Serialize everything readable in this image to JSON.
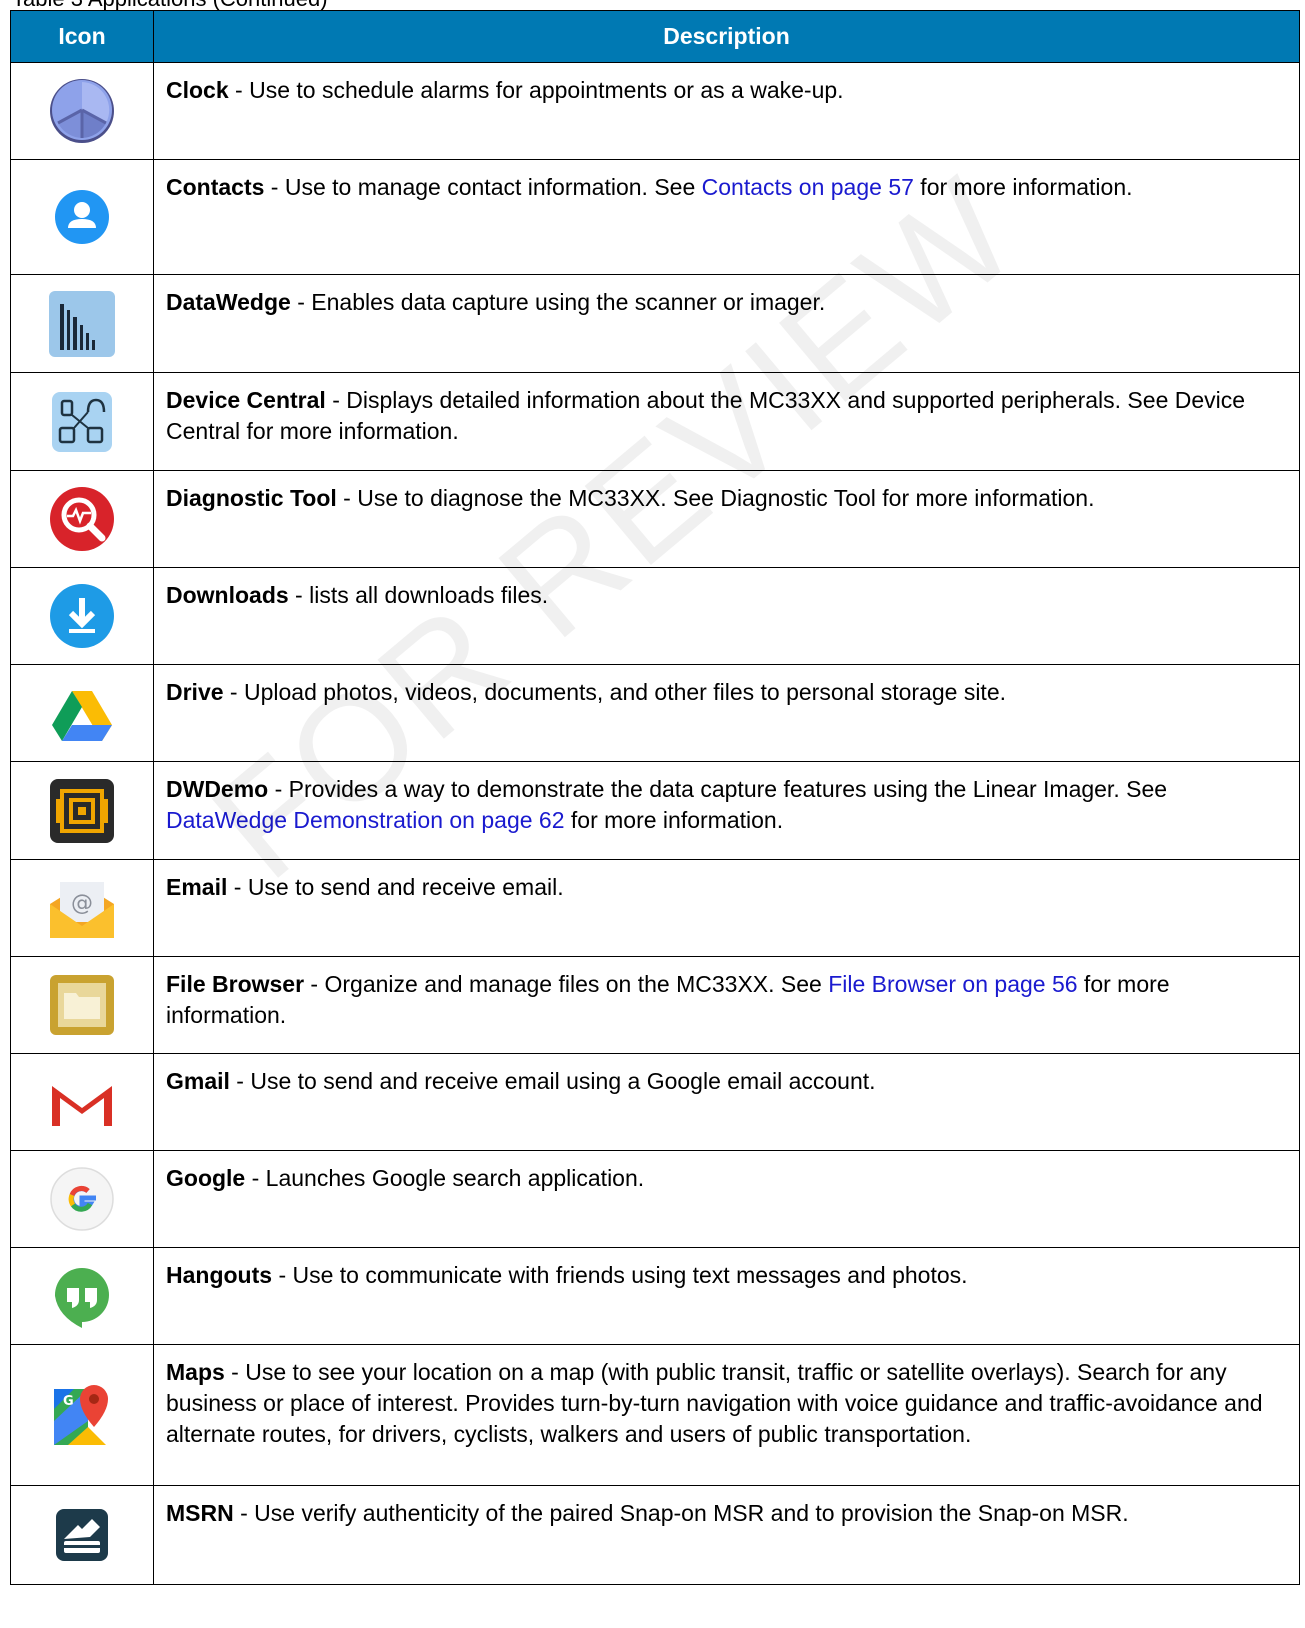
{
  "caption": "Table 3   Applications (Continued)",
  "watermark": "FOR REVIEW",
  "header": {
    "icon": "Icon",
    "description": "Description"
  },
  "rows": [
    {
      "icon": "clock-icon",
      "name": "Clock",
      "text": " - Use to schedule alarms for appointments or as a wake-up.",
      "link": "",
      "after": ""
    },
    {
      "icon": "contacts-icon",
      "name": "Contacts",
      "text": " - Use to manage contact information. See ",
      "link": "Contacts on page 57",
      "after": " for more information."
    },
    {
      "icon": "datawedge-icon",
      "name": "DataWedge",
      "text": " - Enables data capture using the scanner or imager.",
      "link": "",
      "after": ""
    },
    {
      "icon": "device-central-icon",
      "name": "Device Central",
      "text": " - Displays detailed information about the MC33XX and supported peripherals. See Device Central for more information.",
      "link": "",
      "after": ""
    },
    {
      "icon": "diagnostic-tool-icon",
      "name": "Diagnostic Tool",
      "text": " - Use to diagnose the MC33XX. See Diagnostic Tool for more information.",
      "link": "",
      "after": ""
    },
    {
      "icon": "downloads-icon",
      "name": "Downloads",
      "text": " - lists all downloads files.",
      "link": "",
      "after": ""
    },
    {
      "icon": "drive-icon",
      "name": "Drive",
      "text": " - Upload photos, videos, documents, and other files to personal storage site.",
      "link": "",
      "after": ""
    },
    {
      "icon": "dwdemo-icon",
      "name": "DWDemo",
      "text": " - Provides a way to demonstrate the data capture features using the Linear Imager. See ",
      "link": "DataWedge Demonstration on page 62",
      "after": " for more information."
    },
    {
      "icon": "email-icon",
      "name": "Email",
      "text": " - Use to send and receive email.",
      "link": "",
      "after": ""
    },
    {
      "icon": "file-browser-icon",
      "name": "File Browser",
      "text": " - Organize and manage files on the MC33XX. See ",
      "link": "File Browser on page 56",
      "after": " for more information."
    },
    {
      "icon": "gmail-icon",
      "name": "Gmail",
      "text": " - Use to send and receive email using a Google email account.",
      "link": "",
      "after": ""
    },
    {
      "icon": "google-icon",
      "name": "Google",
      "text": " - Launches Google search application.",
      "link": "",
      "after": ""
    },
    {
      "icon": "hangouts-icon",
      "name": "Hangouts",
      "text": " - Use to communicate with friends using text messages and photos.",
      "link": "",
      "after": ""
    },
    {
      "icon": "maps-icon",
      "name": "Maps",
      "text": " - Use to see your location on a map (with public transit, traffic or satellite overlays). Search for any business or place of interest. Provides turn-by-turn navigation with voice guidance and traffic-avoidance and alternate routes, for drivers, cyclists, walkers and users of public transportation.",
      "link": "",
      "after": ""
    },
    {
      "icon": "msrn-icon",
      "name": "MSRN",
      "text": " - Use verify authenticity of the paired Snap-on MSR and to provision the Snap-on MSR.",
      "link": "",
      "after": ""
    }
  ]
}
